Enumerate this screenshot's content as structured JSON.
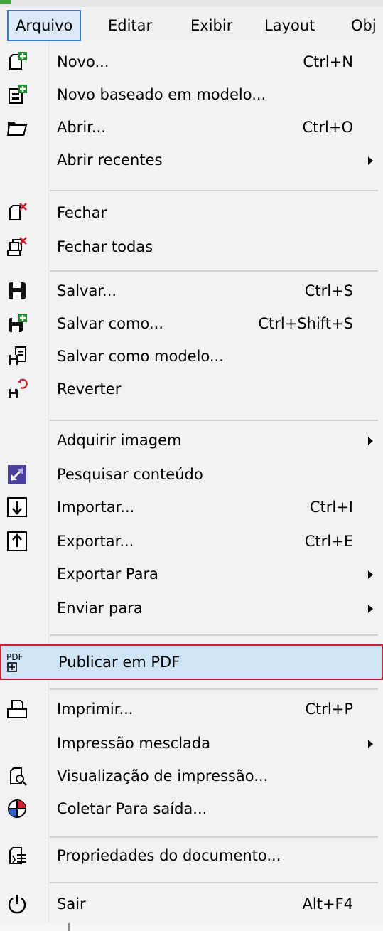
{
  "menubar": {
    "items": [
      {
        "label": "Arquivo",
        "active": true
      },
      {
        "label": "Editar"
      },
      {
        "label": "Exibir"
      },
      {
        "label": "Layout"
      },
      {
        "label": "Obj"
      }
    ]
  },
  "menu": {
    "items": [
      {
        "label": "Novo...",
        "shortcut": "Ctrl+N",
        "icon": "new-document-icon"
      },
      {
        "label": "Novo baseado em modelo...",
        "icon": "new-from-template-icon"
      },
      {
        "label": "Abrir...",
        "shortcut": "Ctrl+O",
        "icon": "folder-open-icon"
      },
      {
        "label": "Abrir recentes",
        "submenu": true
      },
      {
        "label": "Fechar",
        "icon": "close-document-icon"
      },
      {
        "label": "Fechar todas",
        "icon": "close-all-icon"
      },
      {
        "label": "Salvar...",
        "shortcut": "Ctrl+S",
        "icon": "save-icon"
      },
      {
        "label": "Salvar como...",
        "shortcut": "Ctrl+Shift+S",
        "icon": "save-as-icon"
      },
      {
        "label": "Salvar como modelo...",
        "icon": "save-as-template-icon"
      },
      {
        "label": "Reverter",
        "icon": "revert-icon"
      },
      {
        "label": "Adquirir imagem",
        "submenu": true
      },
      {
        "label": "Pesquisar conteúdo",
        "icon": "search-content-icon"
      },
      {
        "label": "Importar...",
        "shortcut": "Ctrl+I",
        "icon": "import-icon"
      },
      {
        "label": "Exportar...",
        "shortcut": "Ctrl+E",
        "icon": "export-icon"
      },
      {
        "label": "Exportar Para",
        "submenu": true
      },
      {
        "label": "Enviar para",
        "submenu": true
      },
      {
        "label": "Publicar em PDF",
        "icon": "pdf-icon",
        "highlighted": true
      },
      {
        "label": "Imprimir...",
        "shortcut": "Ctrl+P",
        "icon": "print-icon"
      },
      {
        "label": "Impressão mesclada",
        "submenu": true
      },
      {
        "label": "Visualização de impressão...",
        "icon": "print-preview-icon"
      },
      {
        "label": "Coletar Para saída...",
        "icon": "collect-for-output-icon"
      },
      {
        "label": "Propriedades do documento...",
        "icon": "document-properties-icon"
      },
      {
        "label": "Sair",
        "shortcut": "Alt+F4",
        "icon": "power-icon"
      }
    ]
  },
  "colors": {
    "highlight_fill": "#cfe5f7",
    "highlight_border": "#c0243a",
    "active_menu_border": "#3a78c2"
  },
  "pdf_icon_text": "PDF"
}
